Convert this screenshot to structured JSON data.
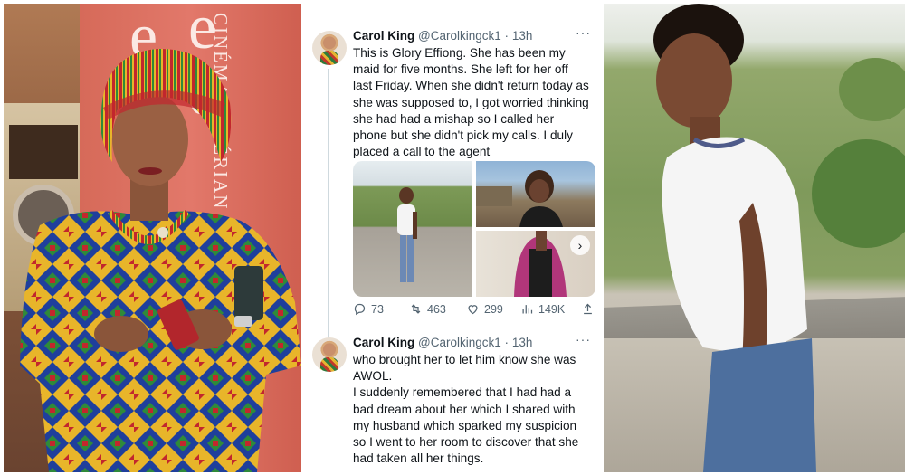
{
  "left_photo": {
    "banner_text": "CINÉMA NIGÉRIAN"
  },
  "tweets": [
    {
      "name": "Carol King",
      "handle": "@Carolkingck1",
      "sep": "·",
      "time": "13h",
      "more": "···",
      "text": "This is Glory Effiong. She has been my maid for five months. She left for her off last Friday. When she didn't return today as she was supposed to, I got worried thinking she had had a mishap so I called her phone but she didn't pick my calls. I duly placed a call to the agent",
      "stats": {
        "replies": "73",
        "retweets": "463",
        "likes": "299",
        "views": "149K"
      }
    },
    {
      "name": "Carol King",
      "handle": "@Carolkingck1",
      "sep": "·",
      "time": "13h",
      "more": "···",
      "text": "who brought her to let him know she was AWOL.\nI suddenly remembered that I had had a bad dream about her which I shared with my husband which sparked my suspicion so I went to her room to discover that she had taken all her things."
    }
  ],
  "icons": [
    "reply-icon",
    "retweet-icon",
    "like-icon",
    "views-icon",
    "share-icon",
    "next-arrow-icon"
  ],
  "colors": {
    "text": "#0f1419",
    "muted": "#536471",
    "banner": "#d66a59"
  }
}
